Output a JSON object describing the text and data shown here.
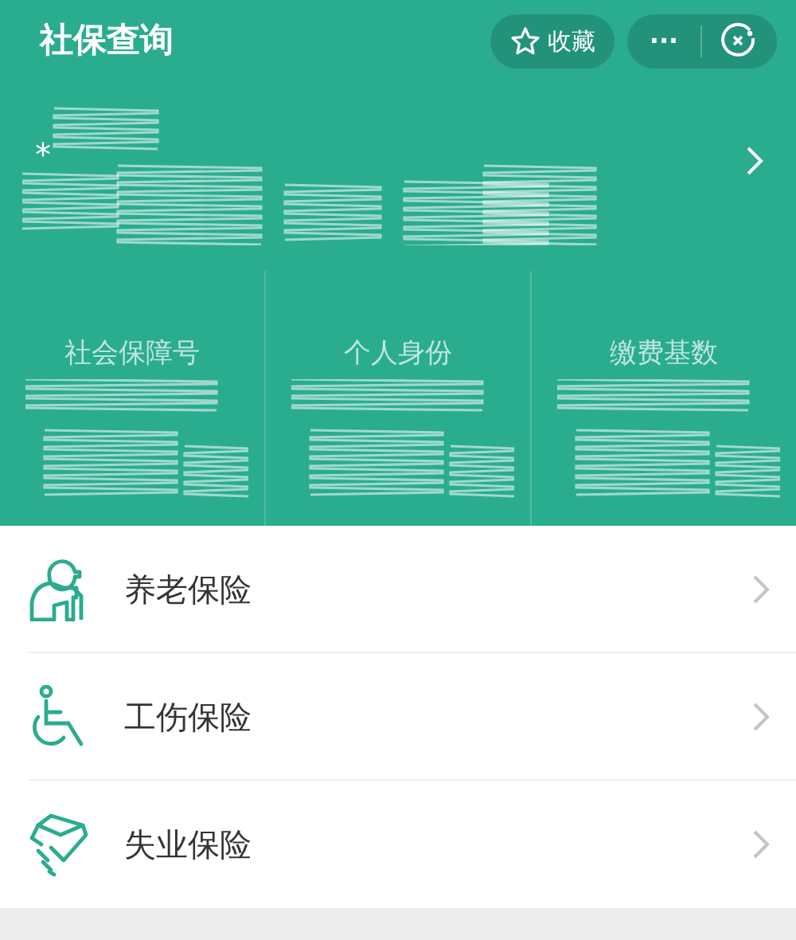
{
  "header": {
    "title": "社保查询",
    "favorite_label": "收藏",
    "more_label": "···"
  },
  "profile": {
    "prefix": "*",
    "redacted": true
  },
  "stats": [
    {
      "label": "社会保障号",
      "redacted": true
    },
    {
      "label": "个人身份",
      "redacted": true
    },
    {
      "label": "缴费基数",
      "redacted": true
    }
  ],
  "menu": [
    {
      "label": "养老保险",
      "kind": "elderly"
    },
    {
      "label": "工伤保险",
      "kind": "wheelchair"
    },
    {
      "label": "失业保险",
      "kind": "hand"
    }
  ]
}
